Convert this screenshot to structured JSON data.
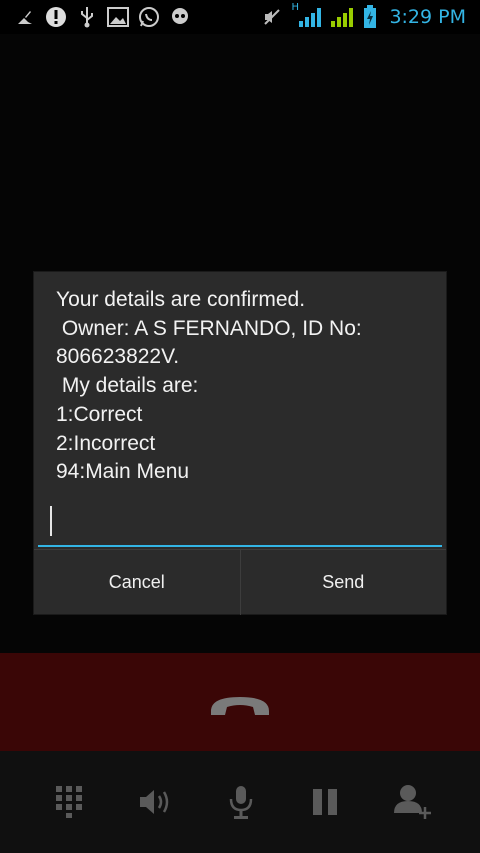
{
  "status_bar": {
    "time": "3:29 PM",
    "network_type": "H",
    "accent_color": "#33b5e5",
    "left_icons": [
      "cleaner-icon",
      "alert-icon",
      "usb-icon",
      "gallery-icon",
      "whatsapp-icon",
      "hangouts-icon"
    ],
    "right_icons": [
      "mute-icon",
      "signal-h-icon",
      "signal-icon",
      "battery-charging-icon"
    ]
  },
  "dialog": {
    "message": "Your details are confirmed.\n Owner: A S FERNANDO, ID No:\n806623822V.\n My details are:\n1:Correct\n2:Incorrect\n94:Main Menu",
    "input_value": "",
    "cancel_label": "Cancel",
    "send_label": "Send"
  },
  "call": {
    "end_call_color": "#3a0606",
    "controls": [
      "dialpad-icon",
      "speaker-icon",
      "mute-mic-icon",
      "hold-icon",
      "add-call-icon"
    ]
  }
}
